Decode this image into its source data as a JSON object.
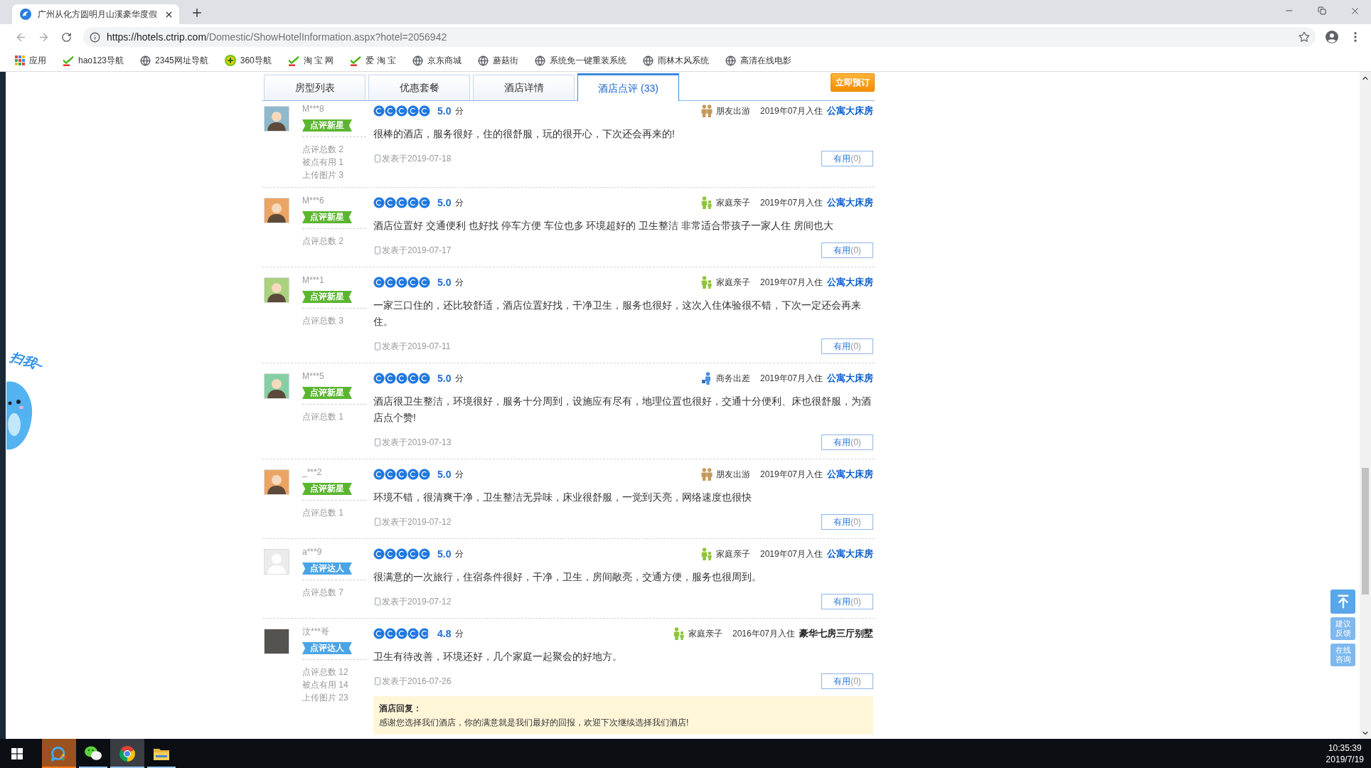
{
  "browser": {
    "tab_title": "广州从化方圆明月山溪豪华度假",
    "url": {
      "host": "https://hotels.ctrip.com",
      "path": "/Domestic/ShowHotelInformation.aspx?hotel=2056942"
    },
    "bookmarks": [
      {
        "kind": "apps",
        "label": "应用"
      },
      {
        "kind": "hao",
        "label": "hao123导航"
      },
      {
        "kind": "globe",
        "label": "2345网址导航"
      },
      {
        "kind": "plus360",
        "label": "360导航"
      },
      {
        "kind": "hao",
        "label": "淘 宝 网"
      },
      {
        "kind": "hao",
        "label": "爱 淘 宝"
      },
      {
        "kind": "globe",
        "label": "京东商城"
      },
      {
        "kind": "globe",
        "label": "蘑菇街"
      },
      {
        "kind": "globe",
        "label": "系统免一键重装系统"
      },
      {
        "kind": "globe",
        "label": "雨林木风系统"
      },
      {
        "kind": "globe",
        "label": "高清在线电影"
      }
    ]
  },
  "page": {
    "tabs": [
      {
        "label": "房型列表",
        "selected": false
      },
      {
        "label": "优惠套餐",
        "selected": false
      },
      {
        "label": "酒店详情",
        "selected": false
      },
      {
        "label": "酒店点评 (33)",
        "selected": true
      }
    ],
    "book_button": "立即预订",
    "reviews": [
      {
        "user": "M***8",
        "avatar": {
          "kind": "cartoon",
          "color": "#8fb9cc"
        },
        "badge": {
          "label": "点评新星",
          "color": "#5cb531"
        },
        "stats": [
          "点评总数 2",
          "被点有用 1",
          "上传图片 3"
        ],
        "stars": 5,
        "score": "5.0",
        "unit": "分",
        "trip": {
          "kind": "friends",
          "label": "朋友出游"
        },
        "stay": "2019年07月入住",
        "room": {
          "label": "公寓大床房",
          "linked": true
        },
        "text": "很棒的酒店，服务很好，住的很舒服，玩的很开心，下次还会再来的!",
        "posted": "发表于2019-07-18",
        "useful": {
          "label": "有用",
          "count": "(0)"
        }
      },
      {
        "user": "M***6",
        "avatar": {
          "kind": "cartoon",
          "color": "#eaa564"
        },
        "badge": {
          "label": "点评新星",
          "color": "#5cb531"
        },
        "stats": [
          "点评总数 2"
        ],
        "stars": 5,
        "score": "5.0",
        "unit": "分",
        "trip": {
          "kind": "family",
          "label": "家庭亲子"
        },
        "stay": "2019年07月入住",
        "room": {
          "label": "公寓大床房",
          "linked": true
        },
        "text": "酒店位置好 交通便利 也好找 停车方便 车位也多 环境超好的 卫生整洁 非常适合带孩子一家人住 房间也大",
        "posted": "发表于2019-07-17",
        "useful": {
          "label": "有用",
          "count": "(0)"
        }
      },
      {
        "user": "M***1",
        "avatar": {
          "kind": "cartoon",
          "color": "#a9d17e"
        },
        "badge": {
          "label": "点评新星",
          "color": "#5cb531"
        },
        "stats": [
          "点评总数 3"
        ],
        "stars": 5,
        "score": "5.0",
        "unit": "分",
        "trip": {
          "kind": "family",
          "label": "家庭亲子"
        },
        "stay": "2019年07月入住",
        "room": {
          "label": "公寓大床房",
          "linked": true
        },
        "text": "一家三口住的，还比较舒适，酒店位置好找，干净卫生，服务也很好，这次入住体验很不错，下次一定还会再来住。",
        "posted": "发表于2019-07-11",
        "useful": {
          "label": "有用",
          "count": "(0)"
        }
      },
      {
        "user": "M***5",
        "avatar": {
          "kind": "cartoon",
          "color": "#86cfa4"
        },
        "badge": {
          "label": "点评新星",
          "color": "#5cb531"
        },
        "stats": [
          "点评总数 1"
        ],
        "stars": 5,
        "score": "5.0",
        "unit": "分",
        "trip": {
          "kind": "business",
          "label": "商务出差"
        },
        "stay": "2019年07月入住",
        "room": {
          "label": "公寓大床房",
          "linked": true
        },
        "text": "酒店很卫生整洁，环境很好，服务十分周到，设施应有尽有，地理位置也很好，交通十分便利、床也很舒服，为酒店点个赞!",
        "posted": "发表于2019-07-13",
        "useful": {
          "label": "有用",
          "count": "(0)"
        }
      },
      {
        "user": "_***2",
        "avatar": {
          "kind": "cartoon",
          "color": "#eaa564"
        },
        "badge": {
          "label": "点评新星",
          "color": "#5cb531"
        },
        "stats": [
          "点评总数 1"
        ],
        "stars": 5,
        "score": "5.0",
        "unit": "分",
        "trip": {
          "kind": "friends",
          "label": "朋友出游"
        },
        "stay": "2019年07月入住",
        "room": {
          "label": "公寓大床房",
          "linked": true
        },
        "text": "环境不错，很清爽干净，卫生整洁无异味，床业很舒服，一觉到天亮，网络速度也很快",
        "posted": "发表于2019-07-12",
        "useful": {
          "label": "有用",
          "count": "(0)"
        }
      },
      {
        "user": "a***9",
        "avatar": {
          "kind": "default"
        },
        "badge": {
          "label": "点评达人",
          "color": "#4aa4e6"
        },
        "stats": [
          "点评总数 7"
        ],
        "stars": 5,
        "score": "5.0",
        "unit": "分",
        "trip": {
          "kind": "family",
          "label": "家庭亲子"
        },
        "stay": "2019年07月入住",
        "room": {
          "label": "公寓大床房",
          "linked": true
        },
        "text": "很满意的一次旅行，住宿条件很好，干净，卫生，房间敞亮，交通方便，服务也很周到。",
        "posted": "发表于2019-07-12",
        "useful": {
          "label": "有用",
          "count": "(0)"
        }
      },
      {
        "user": "汶***哥",
        "avatar": {
          "kind": "photo"
        },
        "badge": {
          "label": "点评达人",
          "color": "#4aa4e6"
        },
        "stats": [
          "点评总数 12",
          "被点有用 14",
          "上传图片 23"
        ],
        "stars": 4.8,
        "score": "4.8",
        "unit": "分",
        "trip": {
          "kind": "family",
          "label": "家庭亲子"
        },
        "stay": "2016年07月入住",
        "room": {
          "label": "豪华七房三厅别墅",
          "linked": false
        },
        "text": "卫生有待改善，环境还好，几个家庭一起聚会的好地方。",
        "posted": "发表于2016-07-26",
        "useful": {
          "label": "有用",
          "count": "(0)"
        },
        "reply": {
          "title": "酒店回复：",
          "text": "感谢您选择我们酒店，你的满意就是我们最好的回报，欢迎下次继续选择我们酒店!"
        }
      }
    ],
    "side_promo": "扫我~",
    "float_tools": [
      "建议反馈",
      "在线咨询"
    ]
  },
  "taskbar": {
    "apps": [
      {
        "kind": "bubble",
        "selected": false,
        "flashing": true
      },
      {
        "kind": "chat",
        "selected": false,
        "flashing": false
      },
      {
        "kind": "browser",
        "selected": true,
        "flashing": false
      },
      {
        "kind": "folder",
        "selected": false,
        "flashing": false
      }
    ],
    "time": "10:35:39",
    "date": "2019/7/19"
  }
}
